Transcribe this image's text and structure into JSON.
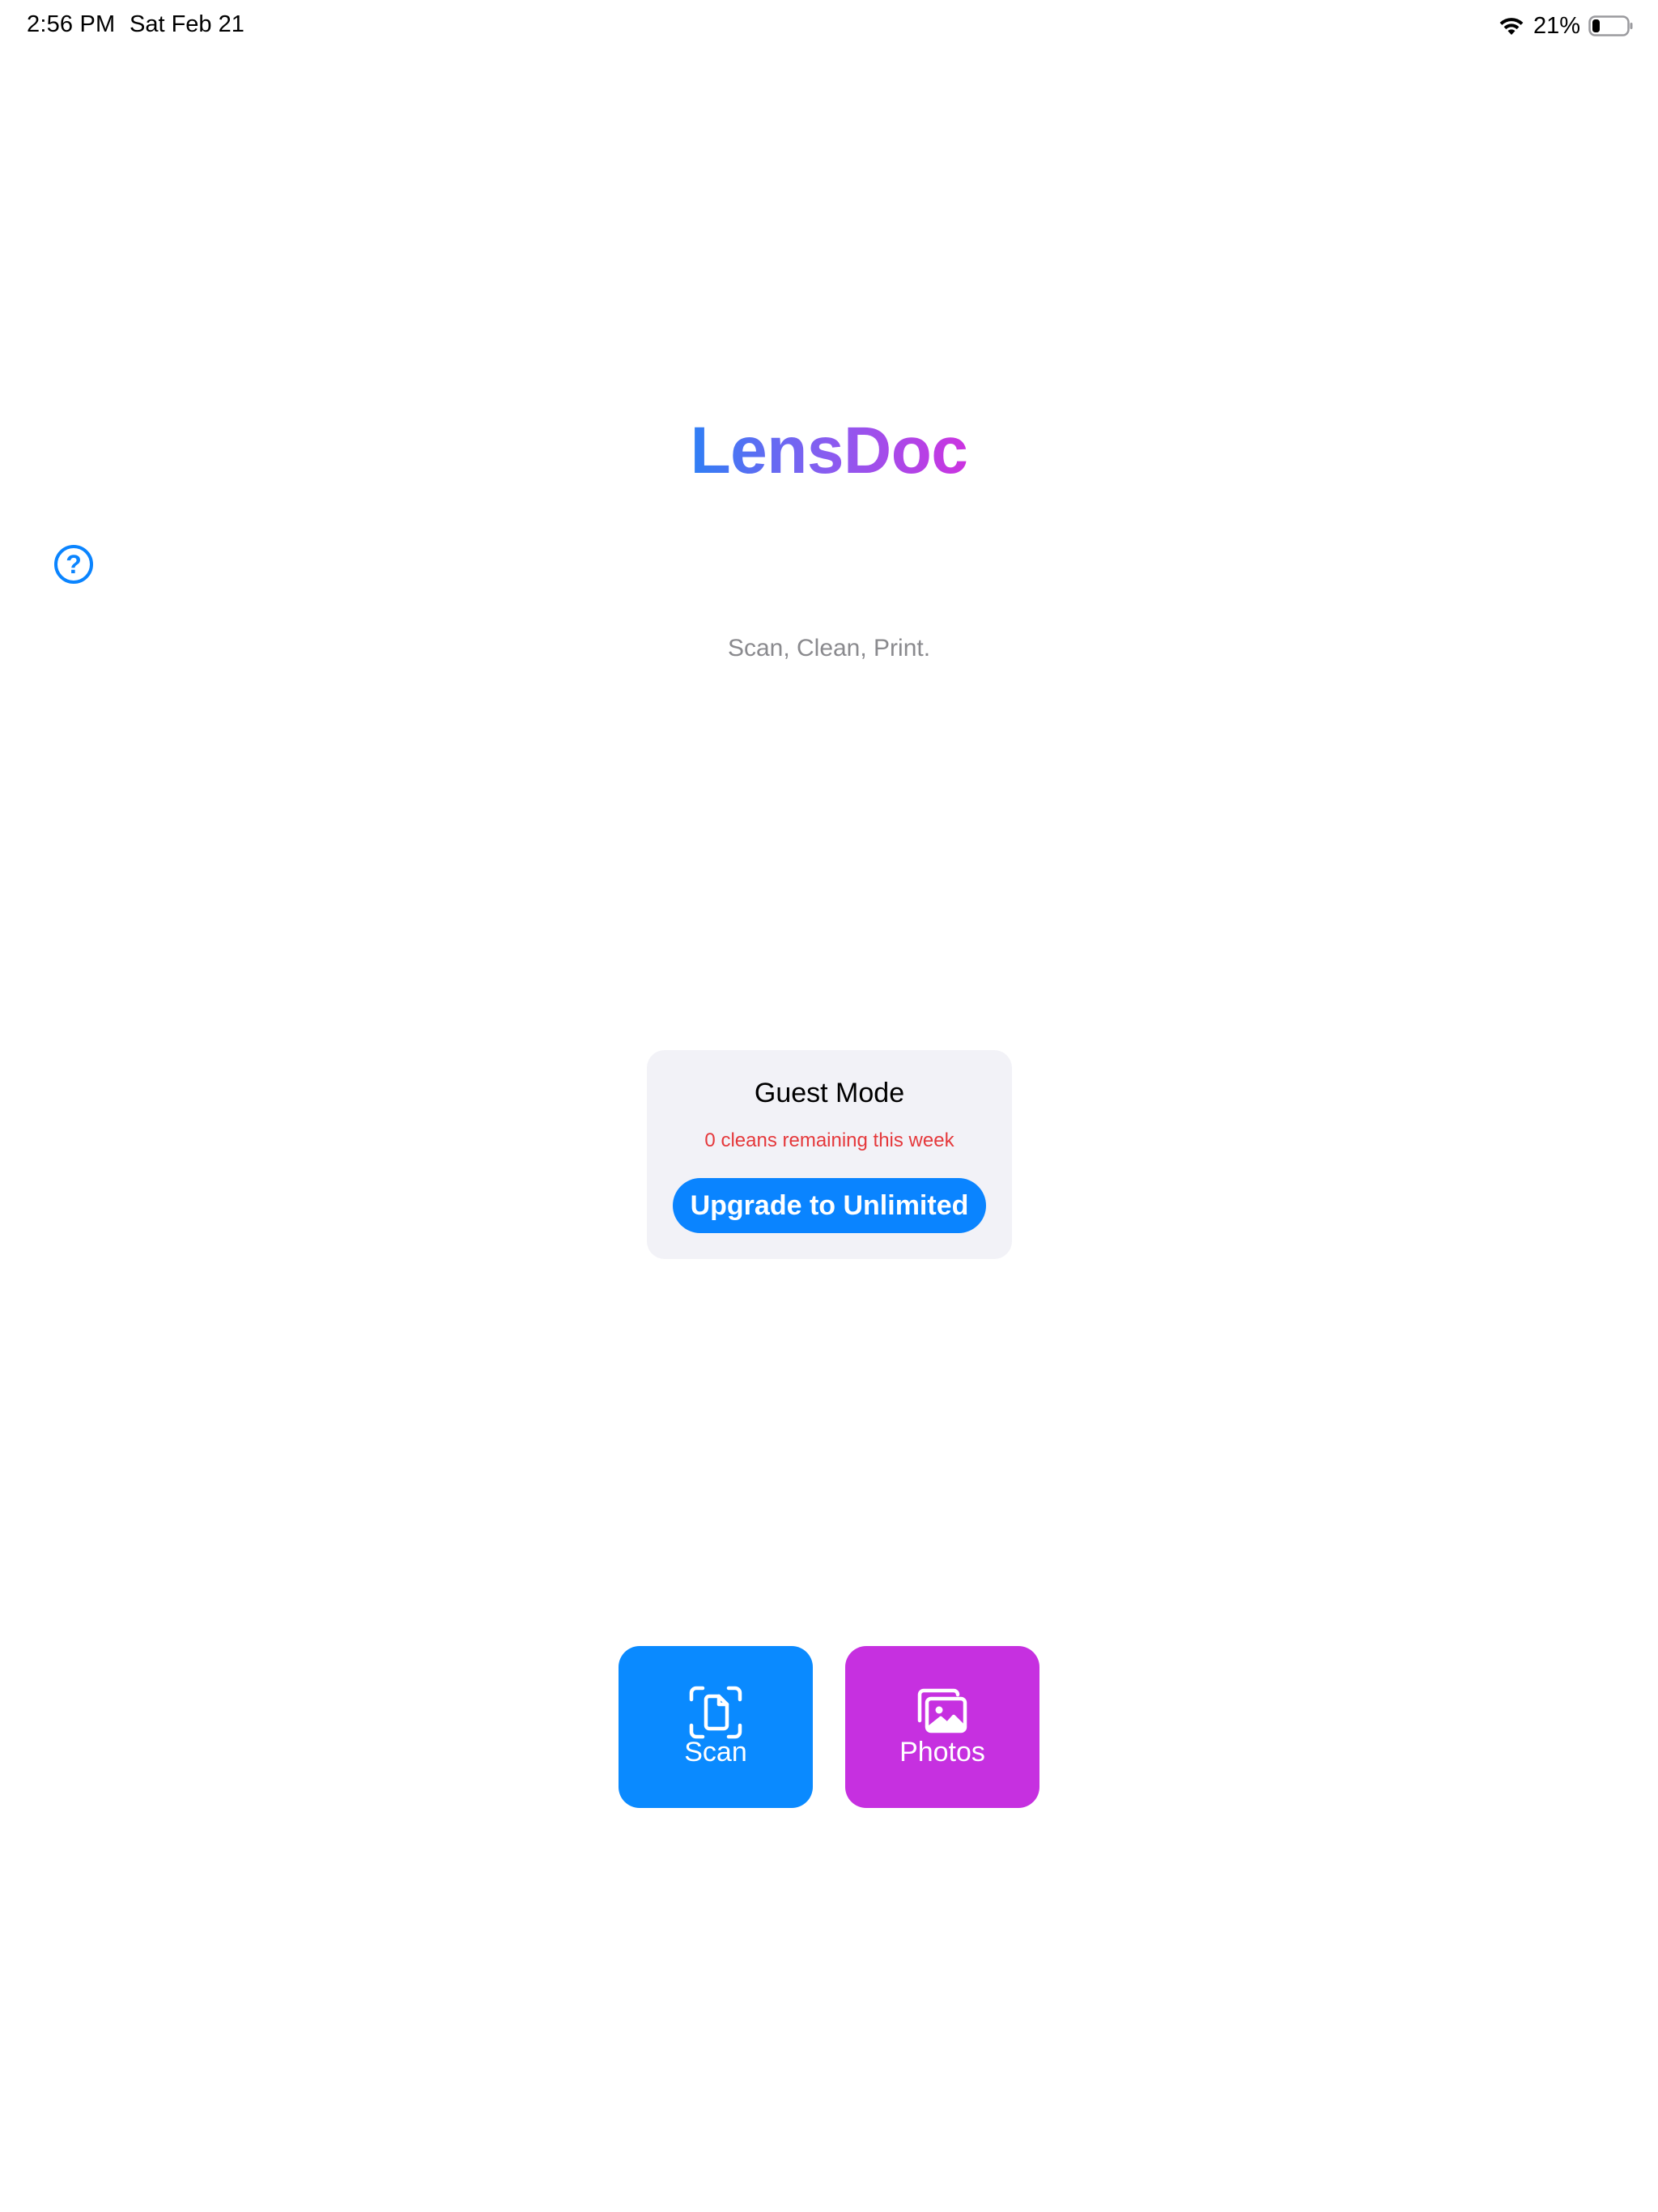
{
  "status_bar": {
    "time": "2:56 PM",
    "date": "Sat Feb 21",
    "battery_percent": "21%",
    "battery_level": 0.21,
    "wifi_icon": "wifi-icon",
    "battery_icon": "battery-icon"
  },
  "help": {
    "icon": "question-circle-icon",
    "symbol": "?"
  },
  "header": {
    "title": "LensDoc",
    "tagline": "Scan, Clean, Print."
  },
  "guest_card": {
    "title": "Guest Mode",
    "remaining": "0 cleans remaining this week",
    "upgrade_label": "Upgrade to Unlimited"
  },
  "actions": {
    "scan": {
      "label": "Scan",
      "icon": "document-scan-icon"
    },
    "photos": {
      "label": "Photos",
      "icon": "photos-icon"
    }
  },
  "colors": {
    "accent_blue": "#0a84ff",
    "photos_purple": "#c630e0",
    "warning_red": "#e5383b",
    "title_gradient_start": "#2f7ff5",
    "title_gradient_end": "#cc33e0"
  }
}
